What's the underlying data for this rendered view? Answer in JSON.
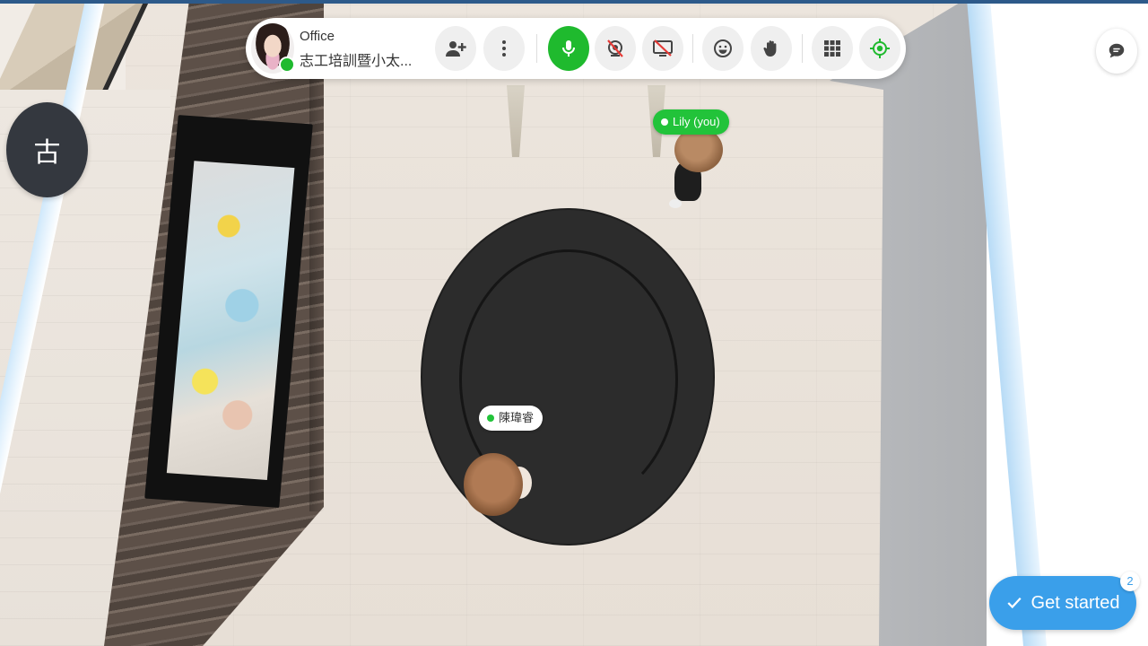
{
  "room": {
    "name": "Office",
    "subtitle": "志工培訓暨小太..."
  },
  "left_button": {
    "label": "古"
  },
  "participants": [
    {
      "name": "Lily (you)",
      "is_self": true
    },
    {
      "name": "陳瑋睿",
      "is_self": false
    }
  ],
  "toolbar": {
    "buttons": [
      {
        "name": "invite",
        "icon": "person-add-icon"
      },
      {
        "name": "more",
        "icon": "more-vertical-icon"
      },
      {
        "name": "microphone",
        "icon": "microphone-icon",
        "state": "on"
      },
      {
        "name": "camera",
        "icon": "camera-off-icon",
        "state": "off"
      },
      {
        "name": "screen-share",
        "icon": "screen-share-off-icon",
        "state": "off"
      },
      {
        "name": "reactions",
        "icon": "smiley-icon"
      },
      {
        "name": "raise-hand",
        "icon": "hand-icon"
      },
      {
        "name": "apps",
        "icon": "grid-icon"
      },
      {
        "name": "locate",
        "icon": "locate-icon"
      }
    ]
  },
  "chat": {
    "icon": "chat-icon"
  },
  "get_started": {
    "label": "Get started",
    "badge": "2"
  },
  "colors": {
    "accent_green": "#1fba2e",
    "accent_blue": "#3a9fea",
    "rug": "#2c2c2c"
  }
}
